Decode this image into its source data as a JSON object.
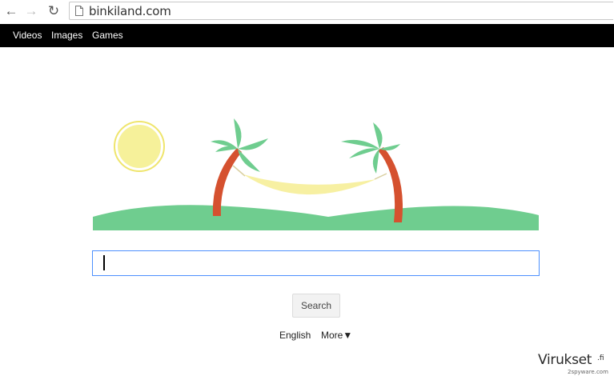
{
  "browser": {
    "url": "binkiland.com",
    "icons": {
      "back": "back-arrow-icon",
      "forward": "forward-arrow-icon",
      "reload": "reload-icon",
      "page": "page-icon"
    }
  },
  "navbar": {
    "items": [
      {
        "label": "Videos"
      },
      {
        "label": "Images"
      },
      {
        "label": "Games"
      }
    ]
  },
  "hero": {
    "colors": {
      "sun_fill": "#f6f19a",
      "sun_ring": "#efe56c",
      "palm_trunk": "#d5512f",
      "palm_leaves": "#6fcd8f",
      "hammock": "#f7f0a2",
      "ground": "#6fcd8f"
    }
  },
  "search": {
    "value": "",
    "button_label": "Search"
  },
  "footer": {
    "language": "English",
    "more": "More▼"
  },
  "watermark": {
    "brand": "Virukset",
    "tld": ".fi",
    "sub": "2spyware.com"
  }
}
